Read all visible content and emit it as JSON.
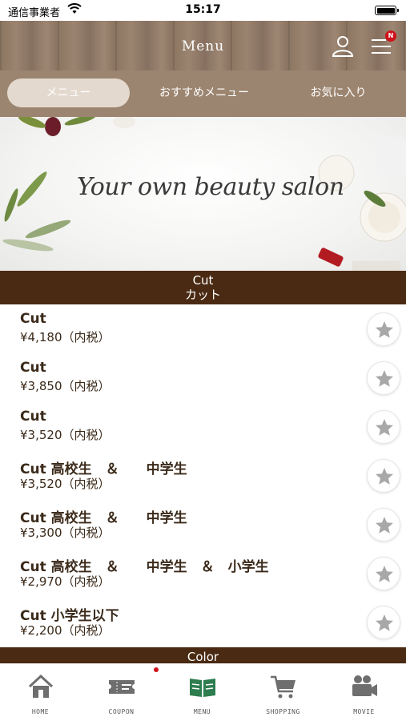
{
  "status_bar": {
    "carrier": "通信事業者",
    "time": "15:17"
  },
  "header": {
    "title": "Menu",
    "badge": "N"
  },
  "tabs": [
    {
      "label": "メニュー",
      "active": true
    },
    {
      "label": "おすすめメニュー",
      "active": false
    },
    {
      "label": "お気に入り",
      "active": false
    }
  ],
  "banner": {
    "text": "Your own beauty salon"
  },
  "sections": {
    "cut": {
      "en": "Cut",
      "jp": "カット"
    },
    "color": {
      "en": "Color"
    }
  },
  "menu_items": [
    {
      "name": "Cut",
      "price": "¥4,180（内税）"
    },
    {
      "name": "Cut",
      "price": "¥3,850（内税）"
    },
    {
      "name": "Cut",
      "price": "¥3,520（内税）"
    },
    {
      "name": "Cut 高校生　＆　　中学生",
      "price": "¥3,520（内税）"
    },
    {
      "name": "Cut 高校生　＆　　中学生",
      "price": "¥3,300（内税）"
    },
    {
      "name": "Cut 高校生　＆　　中学生　＆　小学生",
      "price": "¥2,970（内税）"
    },
    {
      "name": "Cut 小学生以下",
      "price": "¥2,200（内税）"
    }
  ],
  "bottom_nav": [
    {
      "label": "HOME",
      "icon": "home-icon"
    },
    {
      "label": "COUPON",
      "icon": "ticket-icon"
    },
    {
      "label": "MENU",
      "icon": "book-icon"
    },
    {
      "label": "SHOPPING",
      "icon": "cart-icon"
    },
    {
      "label": "MOVIE",
      "icon": "video-camera-icon"
    }
  ],
  "colors": {
    "header_wood": "#8c7662",
    "tab_bar": "#9c8570",
    "active_tab": "#e4d9ce",
    "section_bar": "#4a2a12",
    "star": "#a8a8a8",
    "active_nav": "#2e7d4f",
    "badge": "#d0121b"
  }
}
